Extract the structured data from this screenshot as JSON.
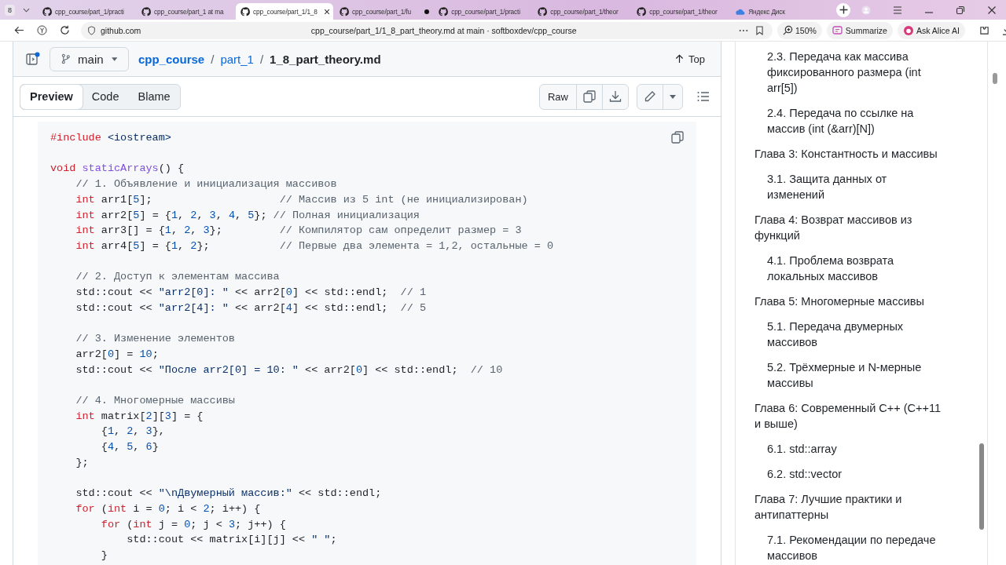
{
  "browser": {
    "tab_count": "8",
    "tabs": [
      {
        "title": "cpp_course/part_1/practi",
        "kind": "github",
        "selected": false,
        "dot": false
      },
      {
        "title": "cpp_course/part_1 at ma",
        "kind": "github",
        "selected": false,
        "dot": false
      },
      {
        "title": "cpp_course/part_1/1_8",
        "kind": "github",
        "selected": true,
        "dot": false
      },
      {
        "title": "cpp_course/part_1/fu",
        "kind": "github",
        "selected": false,
        "dot": true
      },
      {
        "title": "cpp_course/part_1/practi",
        "kind": "github",
        "selected": false,
        "dot": false
      },
      {
        "title": "cpp_course/part_1/theor",
        "kind": "github",
        "selected": false,
        "dot": false
      },
      {
        "title": "cpp_course/part_1/theor",
        "kind": "github",
        "selected": false,
        "dot": false
      },
      {
        "title": "Яндекс Диск",
        "kind": "disk",
        "selected": false,
        "dot": false
      }
    ],
    "host": "github.com",
    "page_title": "cpp_course/part_1/1_8_part_theory.md at main · softboxdev/cpp_course",
    "zoom": "150%",
    "summarize": "Summarize",
    "alice": "Ask Alice AI"
  },
  "repo_header": {
    "branch": "main",
    "separator": "/",
    "breadcrumb": [
      {
        "text": "cpp_course",
        "kind": "repo"
      },
      {
        "text": "part_1",
        "kind": "dir"
      },
      {
        "text": "1_8_part_theory.md",
        "kind": "file"
      }
    ],
    "top": "Top"
  },
  "view_tabs": [
    {
      "label": "Preview",
      "selected": true
    },
    {
      "label": "Code",
      "selected": false
    },
    {
      "label": "Blame",
      "selected": false
    }
  ],
  "raw": "Raw",
  "code": {
    "blocks": [
      [
        [
          {
            "kind": "kw",
            "text": "#include"
          },
          {
            "kind": "s",
            "text": " <iostream>"
          }
        ]
      ],
      [
        [
          {
            "kind": "kw",
            "text": "void"
          },
          {
            "kind": "fn",
            "text": " staticArrays"
          },
          {
            "kind": "p",
            "text": "() {"
          }
        ],
        [
          {
            "kind": "c",
            "text": "    // 1. Объявление и инициализация массивов"
          }
        ],
        [
          {
            "kind": "kw",
            "text": "    int"
          },
          {
            "kind": "p",
            "text": " arr1["
          },
          {
            "kind": "n",
            "text": "5"
          },
          {
            "kind": "p",
            "text": "];"
          },
          {
            "kind": "c",
            "text": "                    // Массив из 5 int (не инициализирован)"
          }
        ],
        [
          {
            "kind": "kw",
            "text": "    int"
          },
          {
            "kind": "p",
            "text": " arr2["
          },
          {
            "kind": "n",
            "text": "5"
          },
          {
            "kind": "p",
            "text": "] = {"
          },
          {
            "kind": "n",
            "text": "1"
          },
          {
            "kind": "p",
            "text": ", "
          },
          {
            "kind": "n",
            "text": "2"
          },
          {
            "kind": "p",
            "text": ", "
          },
          {
            "kind": "n",
            "text": "3"
          },
          {
            "kind": "p",
            "text": ", "
          },
          {
            "kind": "n",
            "text": "4"
          },
          {
            "kind": "p",
            "text": ", "
          },
          {
            "kind": "n",
            "text": "5"
          },
          {
            "kind": "p",
            "text": "};"
          },
          {
            "kind": "c",
            "text": " // Полная инициализация"
          }
        ],
        [
          {
            "kind": "kw",
            "text": "    int"
          },
          {
            "kind": "p",
            "text": " arr3[] = {"
          },
          {
            "kind": "n",
            "text": "1"
          },
          {
            "kind": "p",
            "text": ", "
          },
          {
            "kind": "n",
            "text": "2"
          },
          {
            "kind": "p",
            "text": ", "
          },
          {
            "kind": "n",
            "text": "3"
          },
          {
            "kind": "p",
            "text": "};"
          },
          {
            "kind": "c",
            "text": "         // Компилятор сам определит размер = 3"
          }
        ],
        [
          {
            "kind": "kw",
            "text": "    int"
          },
          {
            "kind": "p",
            "text": " arr4["
          },
          {
            "kind": "n",
            "text": "5"
          },
          {
            "kind": "p",
            "text": "] = {"
          },
          {
            "kind": "n",
            "text": "1"
          },
          {
            "kind": "p",
            "text": ", "
          },
          {
            "kind": "n",
            "text": "2"
          },
          {
            "kind": "p",
            "text": "};"
          },
          {
            "kind": "c",
            "text": "           // Первые два элемента = 1,2, остальные = 0"
          }
        ]
      ],
      [
        [
          {
            "kind": "c",
            "text": "    // 2. Доступ к элементам массива"
          }
        ],
        [
          {
            "kind": "p",
            "text": "    std::cout << "
          },
          {
            "kind": "s",
            "text": "\"arr2[0]: \""
          },
          {
            "kind": "p",
            "text": " << arr2["
          },
          {
            "kind": "n",
            "text": "0"
          },
          {
            "kind": "p",
            "text": "] << std::endl;"
          },
          {
            "kind": "c",
            "text": "  // 1"
          }
        ],
        [
          {
            "kind": "p",
            "text": "    std::cout << "
          },
          {
            "kind": "s",
            "text": "\"arr2[4]: \""
          },
          {
            "kind": "p",
            "text": " << arr2["
          },
          {
            "kind": "n",
            "text": "4"
          },
          {
            "kind": "p",
            "text": "] << std::endl;"
          },
          {
            "kind": "c",
            "text": "  // 5"
          }
        ]
      ],
      [
        [
          {
            "kind": "c",
            "text": "    // 3. Изменение элементов"
          }
        ],
        [
          {
            "kind": "p",
            "text": "    arr2["
          },
          {
            "kind": "n",
            "text": "0"
          },
          {
            "kind": "p",
            "text": "] = "
          },
          {
            "kind": "n",
            "text": "10"
          },
          {
            "kind": "p",
            "text": ";"
          }
        ],
        [
          {
            "kind": "p",
            "text": "    std::cout << "
          },
          {
            "kind": "s",
            "text": "\"После arr2[0] = 10: \""
          },
          {
            "kind": "p",
            "text": " << arr2["
          },
          {
            "kind": "n",
            "text": "0"
          },
          {
            "kind": "p",
            "text": "] << std::endl;"
          },
          {
            "kind": "c",
            "text": "  // 10"
          }
        ]
      ],
      [
        [
          {
            "kind": "c",
            "text": "    // 4. Многомерные массивы"
          }
        ],
        [
          {
            "kind": "kw",
            "text": "    int"
          },
          {
            "kind": "p",
            "text": " matrix["
          },
          {
            "kind": "n",
            "text": "2"
          },
          {
            "kind": "p",
            "text": "]["
          },
          {
            "kind": "n",
            "text": "3"
          },
          {
            "kind": "p",
            "text": "] = {"
          }
        ],
        [
          {
            "kind": "p",
            "text": "        {"
          },
          {
            "kind": "n",
            "text": "1"
          },
          {
            "kind": "p",
            "text": ", "
          },
          {
            "kind": "n",
            "text": "2"
          },
          {
            "kind": "p",
            "text": ", "
          },
          {
            "kind": "n",
            "text": "3"
          },
          {
            "kind": "p",
            "text": "},"
          }
        ],
        [
          {
            "kind": "p",
            "text": "        {"
          },
          {
            "kind": "n",
            "text": "4"
          },
          {
            "kind": "p",
            "text": ", "
          },
          {
            "kind": "n",
            "text": "5"
          },
          {
            "kind": "p",
            "text": ", "
          },
          {
            "kind": "n",
            "text": "6"
          },
          {
            "kind": "p",
            "text": "}"
          }
        ],
        [
          {
            "kind": "p",
            "text": "    };"
          }
        ]
      ],
      [
        [
          {
            "kind": "p",
            "text": "    std::cout << "
          },
          {
            "kind": "s",
            "text": "\"\\nДвумерный массив:\""
          },
          {
            "kind": "p",
            "text": " << std::endl;"
          }
        ],
        [
          {
            "kind": "kw",
            "text": "    for"
          },
          {
            "kind": "p",
            "text": " ("
          },
          {
            "kind": "kw",
            "text": "int"
          },
          {
            "kind": "p",
            "text": " i = "
          },
          {
            "kind": "n",
            "text": "0"
          },
          {
            "kind": "p",
            "text": "; i < "
          },
          {
            "kind": "n",
            "text": "2"
          },
          {
            "kind": "p",
            "text": "; i++) {"
          }
        ],
        [
          {
            "kind": "kw",
            "text": "        for"
          },
          {
            "kind": "p",
            "text": " ("
          },
          {
            "kind": "kw",
            "text": "int"
          },
          {
            "kind": "p",
            "text": " j = "
          },
          {
            "kind": "n",
            "text": "0"
          },
          {
            "kind": "p",
            "text": "; j < "
          },
          {
            "kind": "n",
            "text": "3"
          },
          {
            "kind": "p",
            "text": "; j++) {"
          }
        ],
        [
          {
            "kind": "p",
            "text": "            std::cout << matrix[i][j] << "
          },
          {
            "kind": "s",
            "text": "\" \""
          },
          {
            "kind": "p",
            "text": ";"
          }
        ],
        [
          {
            "kind": "p",
            "text": "        }"
          }
        ]
      ]
    ]
  },
  "toc": {
    "items": [
      {
        "children": [
          {
            "title": "2.3. Передача как массива фиксированного размера (int arr[5])"
          },
          {
            "title": "2.4. Передача по ссылке на массив (int (&arr)[N])"
          }
        ]
      },
      {
        "title": "Глава 3: Константность и массивы",
        "children": [
          {
            "title": "3.1. Защита данных от изменений"
          }
        ]
      },
      {
        "title": "Глава 4: Возврат массивов из функций",
        "children": [
          {
            "title": "4.1. Проблема возврата локальных массивов"
          }
        ]
      },
      {
        "title": "Глава 5: Многомерные массивы",
        "children": [
          {
            "title": "5.1. Передача двумерных массивов"
          },
          {
            "title": "5.2. Трёхмерные и N-мерные массивы"
          }
        ]
      },
      {
        "title": "Глава 6: Современный C++ (C++11 и выше)",
        "children": [
          {
            "title": "6.1. std::array"
          },
          {
            "title": "6.2. std::vector"
          }
        ]
      },
      {
        "title": "Глава 7: Лучшие практики и антипаттерны",
        "children": [
          {
            "title": "7.1. Рекомендации по передаче массивов"
          }
        ]
      }
    ]
  }
}
